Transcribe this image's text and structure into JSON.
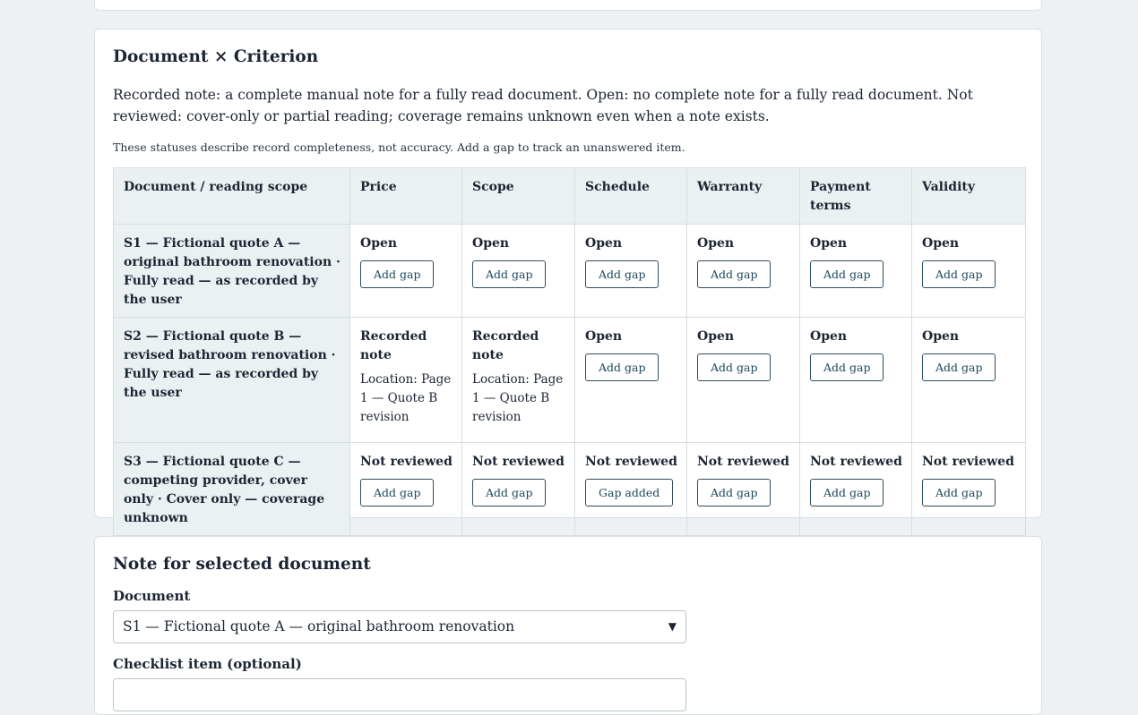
{
  "matrix": {
    "title": "Document × Criterion",
    "description": "Recorded note: a complete manual note for a fully read document. Open: no complete note for a fully read document. Not reviewed: cover-only or partial reading; coverage remains unknown even when a note exists.",
    "hint": "These statuses describe record completeness, not accuracy. Add a gap to track an unanswered item.",
    "headers": [
      "Document / reading scope",
      "Price",
      "Scope",
      "Schedule",
      "Warranty",
      "Payment terms",
      "Validity"
    ],
    "rows": [
      {
        "doc": "S1 — Fictional quote A — original bathroom renovation · Fully read — as recorded by the user",
        "cells": [
          {
            "status": "Open",
            "action": "Add gap"
          },
          {
            "status": "Open",
            "action": "Add gap"
          },
          {
            "status": "Open",
            "action": "Add gap"
          },
          {
            "status": "Open",
            "action": "Add gap"
          },
          {
            "status": "Open",
            "action": "Add gap"
          },
          {
            "status": "Open",
            "action": "Add gap"
          }
        ]
      },
      {
        "doc": "S2 — Fictional quote B — revised bathroom renovation · Fully read — as recorded by the user",
        "cells": [
          {
            "status": "Recorded note",
            "location": "Location: Page 1 — Quote B revision"
          },
          {
            "status": "Recorded note",
            "location": "Location: Page 1 — Quote B revision"
          },
          {
            "status": "Open",
            "action": "Add gap"
          },
          {
            "status": "Open",
            "action": "Add gap"
          },
          {
            "status": "Open",
            "action": "Add gap"
          },
          {
            "status": "Open",
            "action": "Add gap"
          }
        ]
      },
      {
        "doc": "S3 — Fictional quote C — competing provider, cover only · Cover only — coverage unknown",
        "cells": [
          {
            "status": "Not reviewed",
            "action": "Add gap"
          },
          {
            "status": "Not reviewed",
            "action": "Add gap"
          },
          {
            "status": "Not reviewed",
            "action": "Gap added"
          },
          {
            "status": "Not reviewed",
            "action": "Add gap"
          },
          {
            "status": "Not reviewed",
            "action": "Add gap"
          },
          {
            "status": "Not reviewed",
            "action": "Add gap"
          }
        ]
      }
    ]
  },
  "note_form": {
    "title": "Note for selected document",
    "document_label": "Document",
    "document_value": "S1 — Fictional quote A — original bathroom renovation",
    "checklist_label": "Checklist item (optional)"
  }
}
